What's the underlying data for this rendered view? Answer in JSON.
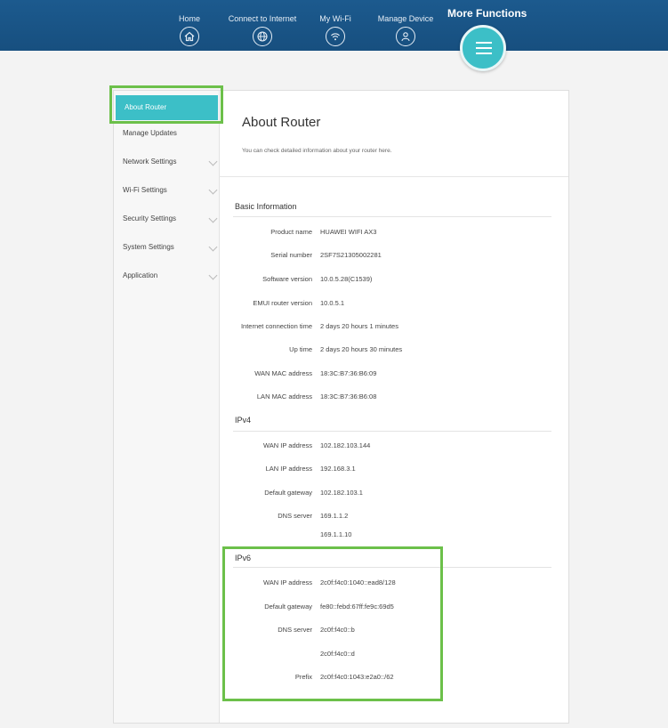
{
  "header": {
    "nav": [
      {
        "label": "Home",
        "icon": "home-icon"
      },
      {
        "label": "Connect to Internet",
        "icon": "globe-icon"
      },
      {
        "label": "My Wi-Fi",
        "icon": "wifi-icon"
      },
      {
        "label": "Manage Device",
        "icon": "user-icon"
      }
    ],
    "more_label": "More Functions",
    "more_icon": "menu-icon"
  },
  "sidebar": {
    "items": [
      {
        "label": "About Router",
        "active": true,
        "expandable": false
      },
      {
        "label": "Manage Updates",
        "active": false,
        "expandable": false
      },
      {
        "label": "Network Settings",
        "active": false,
        "expandable": true
      },
      {
        "label": "Wi-Fi Settings",
        "active": false,
        "expandable": true
      },
      {
        "label": "Security Settings",
        "active": false,
        "expandable": true
      },
      {
        "label": "System Settings",
        "active": false,
        "expandable": true
      },
      {
        "label": "Application",
        "active": false,
        "expandable": true
      }
    ]
  },
  "main": {
    "title": "About Router",
    "description": "You can check detailed information about your router here.",
    "basic": {
      "title": "Basic Information",
      "rows": [
        {
          "label": "Product name",
          "value": "HUAWEI WIFI AX3"
        },
        {
          "label": "Serial number",
          "value": "2SF7S21305002281"
        },
        {
          "label": "Software version",
          "value": "10.0.5.28(C1539)"
        },
        {
          "label": "EMUI router version",
          "value": "10.0.5.1"
        },
        {
          "label": "Internet connection time",
          "value": "2 days 20 hours 1 minutes"
        },
        {
          "label": "Up time",
          "value": "2 days 20 hours 30 minutes"
        },
        {
          "label": "WAN MAC address",
          "value": "18:3C:B7:36:B6:09"
        },
        {
          "label": "LAN MAC address",
          "value": "18:3C:B7:36:B6:08"
        }
      ]
    },
    "ipv4": {
      "title": "IPv4",
      "rows": [
        {
          "label": "WAN IP address",
          "value": "102.182.103.144"
        },
        {
          "label": "LAN IP address",
          "value": "192.168.3.1"
        },
        {
          "label": "Default gateway",
          "value": "102.182.103.1"
        },
        {
          "label": "DNS server",
          "value": "169.1.1.2"
        },
        {
          "label": "",
          "value": "169.1.1.10"
        }
      ]
    },
    "ipv6": {
      "title": "IPv6",
      "rows": [
        {
          "label": "WAN IP address",
          "value": "2c0f:f4c0:1040::ead8/128"
        },
        {
          "label": "Default gateway",
          "value": "fe80::febd:67ff:fe9c:69d5"
        },
        {
          "label": "DNS server",
          "value": "2c0f:f4c0::b"
        },
        {
          "label": "",
          "value": "2c0f:f4c0::d"
        },
        {
          "label": "Prefix",
          "value": "2c0f:f4c0:1043:e2a0::/62"
        }
      ]
    }
  },
  "colors": {
    "header": "#174f7f",
    "accent": "#3cbfc7",
    "highlight": "#6cc04a"
  }
}
